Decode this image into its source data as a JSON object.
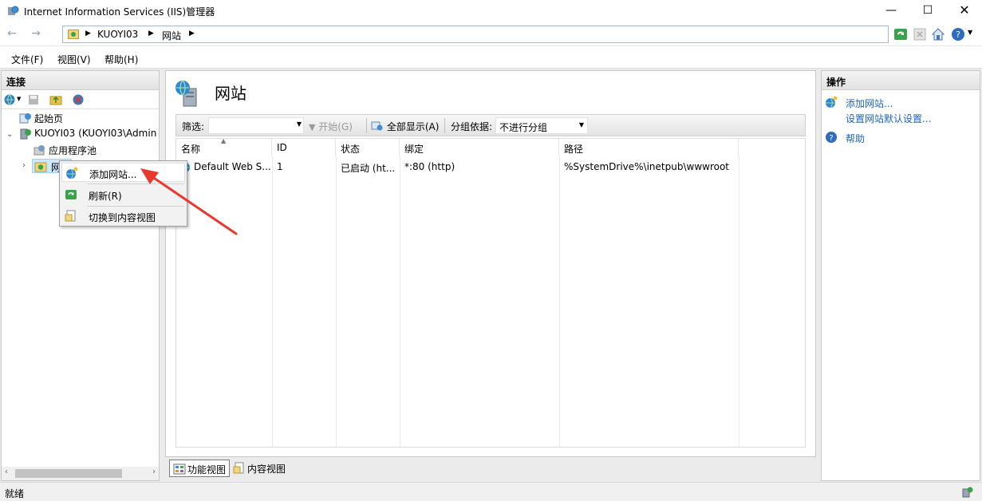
{
  "window": {
    "title": "Internet Information Services (IIS)管理器",
    "minimize": "—",
    "maximize": "☐",
    "close": "✕"
  },
  "nav": {
    "back": "←",
    "forward": "→",
    "breadcrumbs": [
      "KUOYI03",
      "网站"
    ]
  },
  "menu": [
    "文件(F)",
    "视图(V)",
    "帮助(H)"
  ],
  "connections": {
    "header": "连接",
    "tree": {
      "start_page": "起始页",
      "server": "KUOYI03 (KUOYI03\\Admin",
      "app_pools": "应用程序池",
      "sites": "网站"
    }
  },
  "context_menu": {
    "items": [
      "添加网站...",
      "刷新(R)",
      "切换到内容视图"
    ]
  },
  "main": {
    "title": "网站",
    "filter_label": "筛选:",
    "filter_value": "",
    "start_label": "开始(G)",
    "show_all_label": "全部显示(A)",
    "group_by_label": "分组依据:",
    "group_by_value": "不进行分组",
    "columns": [
      "名称",
      "ID",
      "状态",
      "绑定",
      "路径"
    ],
    "rows": [
      {
        "name": "Default Web S...",
        "id": "1",
        "status": "已启动 (ht...",
        "binding": "*:80 (http)",
        "path": "%SystemDrive%\\inetpub\\wwwroot"
      }
    ]
  },
  "bottom_tabs": [
    "功能视图",
    "内容视图"
  ],
  "actions": {
    "header": "操作",
    "items": [
      "添加网站...",
      "设置网站默认设置...",
      "帮助"
    ]
  },
  "status": {
    "text": "就绪"
  },
  "colors": {
    "accent_link": "#1d64c0",
    "annotation": "#e8392f",
    "selection": "#cce8ff"
  }
}
